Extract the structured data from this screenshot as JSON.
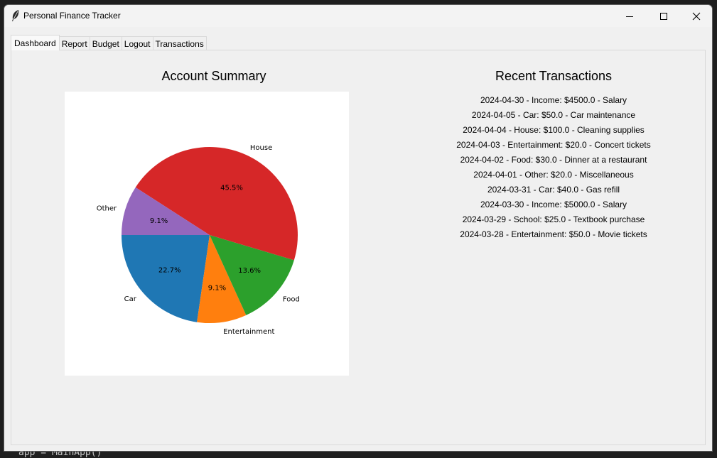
{
  "window": {
    "title": "Personal Finance Tracker",
    "icon": "feather-icon"
  },
  "tabs": [
    {
      "label": "Dashboard",
      "active": true
    },
    {
      "label": "Report"
    },
    {
      "label": "Budget"
    },
    {
      "label": "Logout"
    },
    {
      "label": "Transactions"
    }
  ],
  "dashboard": {
    "summary_title": "Account Summary",
    "recent_title": "Recent Transactions",
    "transactions": [
      "2024-04-30 - Income: $4500.0 - Salary",
      "2024-04-05 - Car: $50.0 - Car maintenance",
      "2024-04-04 - House: $100.0 - Cleaning supplies",
      "2024-04-03 - Entertainment: $20.0 - Concert tickets",
      "2024-04-02 - Food: $30.0 - Dinner at a restaurant",
      "2024-04-01 - Other: $20.0 - Miscellaneous",
      "2024-03-31 - Car: $40.0 - Gas refill",
      "2024-03-30 - Income: $5000.0 - Salary",
      "2024-03-29 - School: $25.0 - Textbook purchase",
      "2024-03-28 - Entertainment: $50.0 - Movie tickets"
    ]
  },
  "editor_peek": {
    "code": "app = MainApp()"
  },
  "chart_data": {
    "type": "pie",
    "title": "",
    "start_angle_deg": 180,
    "slices": [
      {
        "label": "Car",
        "value": 22.7,
        "pct_label": "22.7%",
        "color": "#1f77b4"
      },
      {
        "label": "Entertainment",
        "value": 9.1,
        "pct_label": "9.1%",
        "color": "#ff7f0e"
      },
      {
        "label": "Food",
        "value": 13.6,
        "pct_label": "13.6%",
        "color": "#2ca02c"
      },
      {
        "label": "House",
        "value": 45.5,
        "pct_label": "45.5%",
        "color": "#d62728"
      },
      {
        "label": "Other",
        "value": 9.1,
        "pct_label": "9.1%",
        "color": "#9467bd"
      }
    ]
  }
}
